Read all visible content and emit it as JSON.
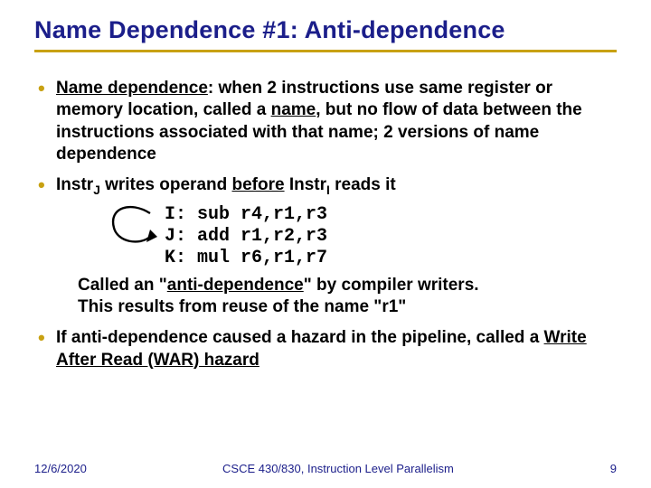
{
  "title": "Name Dependence #1: Anti-dependence",
  "bullet1": {
    "term": "Name dependence",
    "rest1": ": when 2 instructions use same register or memory location, called a ",
    "name_word": "name",
    "rest2": ", but no flow of data between the instructions associated with that name; 2 versions of name dependence"
  },
  "bullet2": {
    "part1": "Instr",
    "subJ": "J",
    "part2": " writes operand ",
    "before_word": "before",
    "part3": " Instr",
    "subI": "I",
    "part4": " reads it"
  },
  "code": {
    "line1": "I: sub r4,r1,r3",
    "line2": "J: add r1,r2,r3",
    "line3": "K: mul r6,r1,r7"
  },
  "after_code": {
    "l1a": "Called an \"",
    "anti": "anti-dependence",
    "l1b": "\" by compiler writers.",
    "l2": "This results from reuse of the name \"r1\""
  },
  "bullet3": {
    "part1": "If anti-dependence caused a hazard in the pipeline, called a ",
    "war": "Write After Read (WAR) hazard"
  },
  "footer": {
    "date": "12/6/2020",
    "course": "CSCE 430/830, Instruction Level Parallelism",
    "page": "9"
  }
}
